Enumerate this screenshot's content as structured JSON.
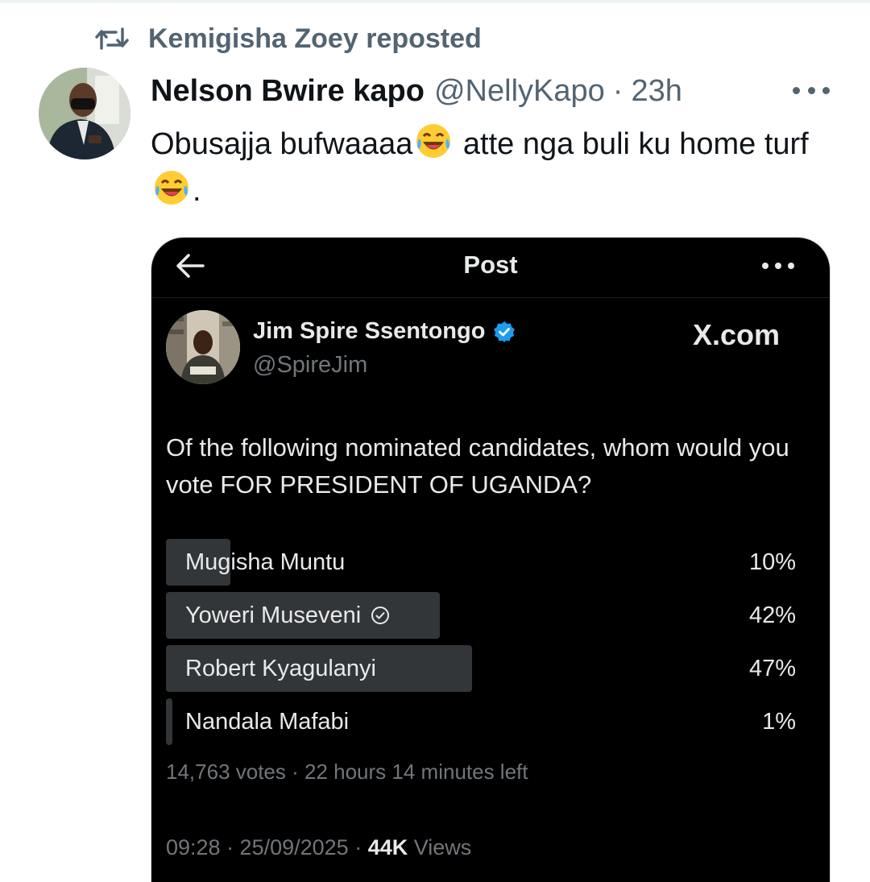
{
  "repost": {
    "label": "Kemigisha Zoey reposted",
    "icon": "repost-icon"
  },
  "tweet": {
    "author_name": "Nelson Bwire kapo",
    "handle": "@NellyKapo",
    "separator": "·",
    "time": "23h",
    "text_part1": "Obusajja bufwaaaa",
    "text_part2": " atte nga buli  ku home turf ",
    "text_part3": "."
  },
  "embedded_post": {
    "nav_title": "Post",
    "author_name": "Jim Spire Ssentongo",
    "handle": "@SpireJim",
    "watermark": "X.com",
    "question": "Of the following nominated candidates, whom would you vote FOR PRESIDENT OF UGANDA?",
    "poll_options": [
      {
        "label": "Mugisha Muntu",
        "percent_text": "10%",
        "percent": 10
      },
      {
        "label": "Yoweri Museveni",
        "percent_text": "42%",
        "percent": 42
      },
      {
        "label": "Robert Kyagulanyi",
        "percent_text": "47%",
        "percent": 47
      },
      {
        "label": "Nandala Mafabi",
        "percent_text": "1%",
        "percent": 1
      }
    ],
    "poll_meta": "14,763 votes · 22 hours 14 minutes left",
    "timestamp": "09:28 · 25/09/2025 · ",
    "views_count": "44K",
    "views_label": " Views"
  },
  "colors": {
    "text_primary": "#0f1419",
    "text_secondary": "#536471",
    "verified_blue": "#1d9bf0",
    "poll_bar": "#333639"
  }
}
